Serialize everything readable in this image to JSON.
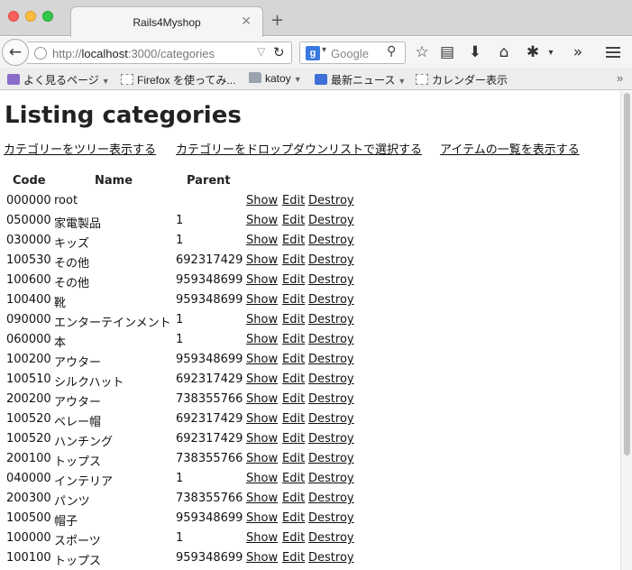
{
  "browser": {
    "tab_title": "Rails4Myshop",
    "url_prefix": "http://",
    "url_host": "localhost",
    "url_rest": ":3000/categories",
    "search_placeholder": "Google",
    "bookmarks": [
      {
        "label": "よく見るページ"
      },
      {
        "label": "Firefox を使ってみ..."
      },
      {
        "label": "katoy"
      },
      {
        "label": "最新ニュース"
      },
      {
        "label": "カレンダー表示"
      }
    ]
  },
  "page": {
    "title": "Listing categories",
    "links": [
      "カテゴリーをツリー表示する",
      "カテゴリーをドロップダウンリストで選択する",
      "アイテムの一覧を表示する"
    ],
    "columns": [
      "Code",
      "Name",
      "Parent"
    ],
    "actions": [
      "Show",
      "Edit",
      "Destroy"
    ],
    "rows": [
      {
        "code": "000000",
        "name": "root",
        "parent": ""
      },
      {
        "code": "050000",
        "name": "家電製品",
        "parent": "1"
      },
      {
        "code": "030000",
        "name": "キッズ",
        "parent": "1"
      },
      {
        "code": "100530",
        "name": "その他",
        "parent": "692317429"
      },
      {
        "code": "100600",
        "name": "その他",
        "parent": "959348699"
      },
      {
        "code": "100400",
        "name": "靴",
        "parent": "959348699"
      },
      {
        "code": "090000",
        "name": "エンターテインメント",
        "parent": "1"
      },
      {
        "code": "060000",
        "name": "本",
        "parent": "1"
      },
      {
        "code": "100200",
        "name": "アウター",
        "parent": "959348699"
      },
      {
        "code": "100510",
        "name": "シルクハット",
        "parent": "692317429"
      },
      {
        "code": "200200",
        "name": "アウター",
        "parent": "738355766"
      },
      {
        "code": "100520",
        "name": "ベレー帽",
        "parent": "692317429"
      },
      {
        "code": "100520",
        "name": "ハンチング",
        "parent": "692317429"
      },
      {
        "code": "200100",
        "name": "トップス",
        "parent": "738355766"
      },
      {
        "code": "040000",
        "name": "インテリア",
        "parent": "1"
      },
      {
        "code": "200300",
        "name": "パンツ",
        "parent": "738355766"
      },
      {
        "code": "100500",
        "name": "帽子",
        "parent": "959348699"
      },
      {
        "code": "100000",
        "name": "スポーツ",
        "parent": "1"
      },
      {
        "code": "100100",
        "name": "トップス",
        "parent": "959348699"
      }
    ]
  }
}
